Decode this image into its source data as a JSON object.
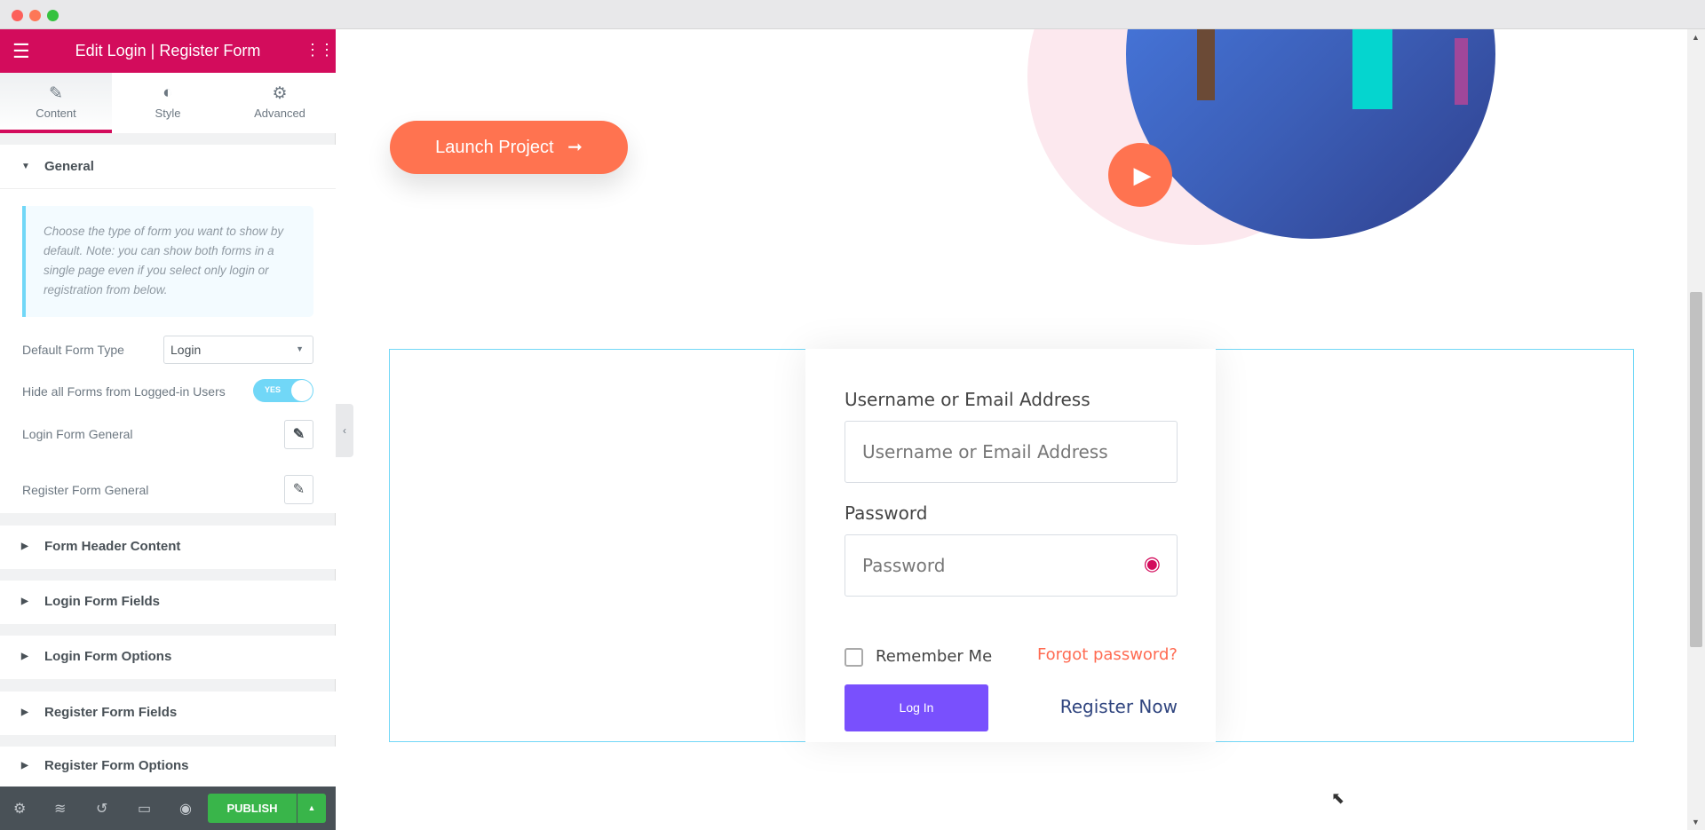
{
  "window": {
    "controls": [
      "close",
      "minimize",
      "maximize"
    ]
  },
  "panel": {
    "title": "Edit Login | Register Form",
    "tabs": [
      {
        "label": "Content",
        "icon": "pencil-icon",
        "active": true
      },
      {
        "label": "Style",
        "icon": "half-circle-icon"
      },
      {
        "label": "Advanced",
        "icon": "gear-icon"
      }
    ],
    "general": {
      "title": "General",
      "description": "Choose the type of form you want to show by default. Note: you can show both forms in a single page even if you select only login or registration from below.",
      "default_form_type_label": "Default Form Type",
      "default_form_type_value": "Login",
      "hide_forms_label": "Hide all Forms from Logged-in Users",
      "hide_forms_toggle": "YES",
      "login_form_general": "Login Form General",
      "register_form_general": "Register Form General"
    },
    "sections": [
      "Form Header Content",
      "Login Form Fields",
      "Login Form Options",
      "Register Form Fields",
      "Register Form Options"
    ],
    "footer": {
      "publish": "PUBLISH"
    }
  },
  "canvas": {
    "launch_button": "Launch Project",
    "form": {
      "username_label": "Username or Email Address",
      "username_placeholder": "Username or Email Address",
      "password_label": "Password",
      "password_placeholder": "Password",
      "remember_me": "Remember Me",
      "forgot_password": "Forgot password?",
      "login_button": "Log In",
      "register_link": "Register Now"
    }
  },
  "colors": {
    "brand": "#d30c5c",
    "launch": "#ff7350",
    "login_button": "#7950fd",
    "publish": "#39b54a",
    "forgot": "#ff6b52",
    "register": "#30457f"
  }
}
